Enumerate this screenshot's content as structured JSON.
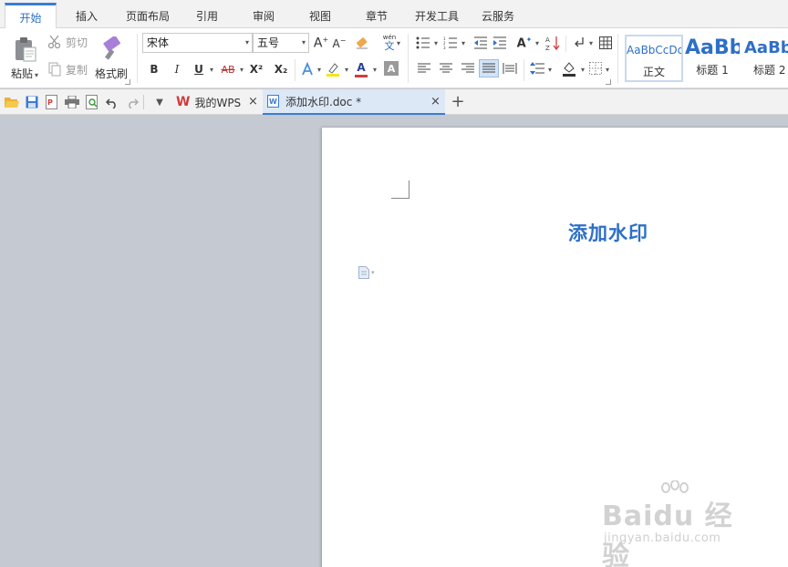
{
  "menu_tabs": [
    "开始",
    "插入",
    "页面布局",
    "引用",
    "审阅",
    "视图",
    "章节",
    "开发工具",
    "云服务"
  ],
  "clipboard": {
    "paste": "粘贴",
    "cut": "剪切",
    "copy": "复制",
    "format_painter": "格式刷"
  },
  "font": {
    "name": "宋体",
    "size": "五号",
    "phonetic_top": "wén",
    "phonetic_char": "文"
  },
  "format_buttons": {
    "bold": "B",
    "italic": "I",
    "underline": "U",
    "strike": "AB",
    "superscript": "X²",
    "subscript": "X₂",
    "font_color": "A",
    "char_shading": "A"
  },
  "styles": [
    {
      "preview": "AaBbCcDd",
      "name": "正文"
    },
    {
      "preview": "AaBb",
      "name": "标题 1"
    },
    {
      "preview": "AaBb",
      "name": "标题 2"
    }
  ],
  "doc_tabs": [
    {
      "label": "我的WPS"
    },
    {
      "label": "添加水印.doc *"
    }
  ],
  "document": {
    "title": "添加水印"
  },
  "watermark": {
    "main": "Baidu 经验",
    "sub": "jingyan.baidu.com"
  },
  "colors": {
    "accent": "#2e6fc7",
    "tab_active_border": "#3b7bd6",
    "workspace": "#c5c9d1"
  }
}
